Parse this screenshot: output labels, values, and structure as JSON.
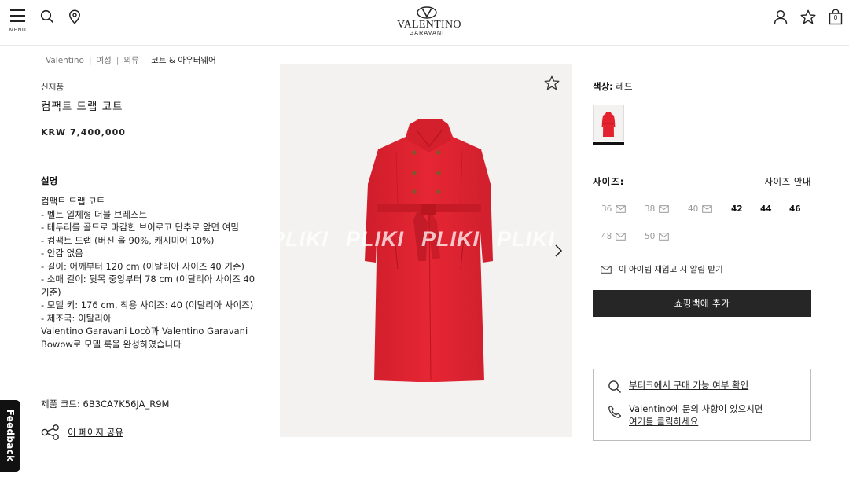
{
  "header": {
    "menu_label": "MENU",
    "logo_main": "VALENTINO",
    "logo_sub": "GARAVANI",
    "bag_count": "0"
  },
  "breadcrumb": {
    "items": [
      "Valentino",
      "여성",
      "의류",
      "코트 & 아우터웨어"
    ],
    "separator": "|"
  },
  "product": {
    "badge": "신제품",
    "name": "컴팩트 드랩 코트",
    "price": "KRW 7,400,000",
    "description_heading": "설명",
    "description_lines": [
      "컴팩트 드랩 코트",
      "- 벨트 일체형 더블 브레스트",
      "- 테두리를 골드로 마감한 브이로고 단추로 앞면 여밈",
      "- 컴팩트 드랩 (버진 울 90%, 캐시미어 10%)",
      "- 안감 없음",
      "- 길이: 어깨부터 120 cm (이탈리아 사이즈 40 기준)",
      "- 소매 길이: 뒷목 중앙부터 78 cm (이탈리아 사이즈 40 기준)",
      "- 모델 키: 176 cm, 착용 사이즈: 40 (이탈리아 사이즈)",
      "- 제조국: 이탈리아",
      "Valentino Garavani Locò과 Valentino Garavani Bowow로 모델 룩을 완성하였습니다"
    ],
    "code": "제품 코드: 6B3CA7K56JA_R9M",
    "share_label": "이 페이지 공유",
    "watermark": "PLIKI",
    "coat_color": "#e3222f"
  },
  "options": {
    "color_label": "색상:",
    "color_value": "레드",
    "size_label": "사이즈:",
    "size_guide": "사이즈 안내",
    "sizes": [
      {
        "label": "36",
        "available": false
      },
      {
        "label": "38",
        "available": false
      },
      {
        "label": "40",
        "available": false
      },
      {
        "label": "42",
        "available": true
      },
      {
        "label": "44",
        "available": true
      },
      {
        "label": "46",
        "available": true
      },
      {
        "label": "48",
        "available": false
      },
      {
        "label": "50",
        "available": false
      }
    ],
    "notify_label": "이 아이템 재입고 시 알림 받기",
    "add_to_bag": "쇼핑백에 추가"
  },
  "help": {
    "boutique_check": "부티크에서 구매 가능 여부 확인",
    "contact_line1": "Valentino에 문의 사항이 있으시면",
    "contact_line2": "여기를 클릭하세요"
  },
  "feedback_label": "Feedback"
}
